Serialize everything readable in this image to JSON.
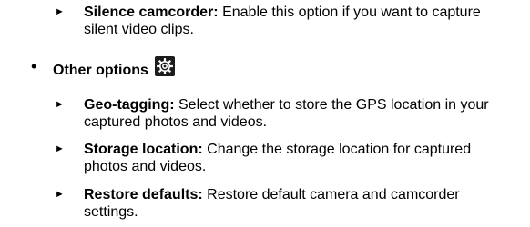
{
  "items": {
    "silence": {
      "bullet": "►",
      "title": "Silence camcorder:",
      "text": " Enable this option if you want to capture silent video clips."
    },
    "other": {
      "bullet": "•",
      "label": "Other options",
      "icon": "settings-gear-icon"
    },
    "geo": {
      "bullet": "►",
      "title": "Geo-tagging:",
      "text": " Select whether to store the GPS location in your captured photos and videos."
    },
    "storage": {
      "bullet": "►",
      "title": "Storage location:",
      "text": " Change the storage location for captured photos and videos."
    },
    "restore": {
      "bullet": "►",
      "title": "Restore defaults:",
      "text": " Restore default camera and camcorder settings."
    }
  },
  "colors": {
    "text": "#000000",
    "icon_bg": "#1c1c1c",
    "icon_fg": "#ffffff"
  }
}
